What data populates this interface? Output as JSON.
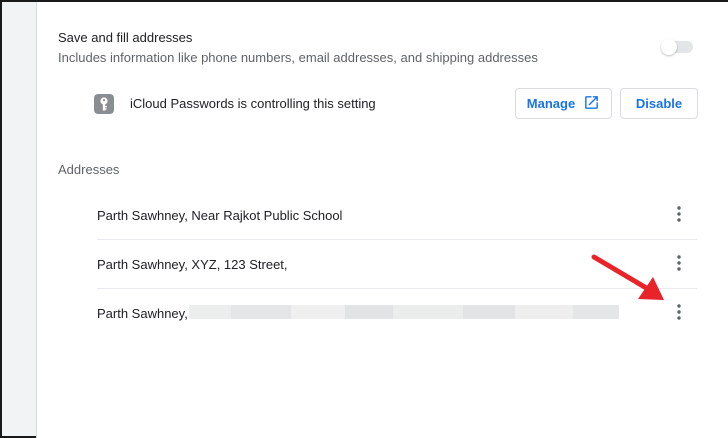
{
  "autofill": {
    "title": "Save and fill addresses",
    "subtitle": "Includes information like phone numbers, email addresses, and shipping addresses",
    "toggle_state": "off"
  },
  "policy": {
    "text": "iCloud Passwords is controlling this setting",
    "icon": "key-icon",
    "manage_label": "Manage",
    "manage_icon": "open-in-new-icon",
    "disable_label": "Disable"
  },
  "addresses": {
    "section_label": "Addresses",
    "items": [
      {
        "text": "Parth Sawhney, Near Rajkot Public School"
      },
      {
        "text": "Parth Sawhney, XYZ, 123 Street,"
      },
      {
        "text": "Parth Sawhney,"
      }
    ]
  },
  "colors": {
    "accent": "#1a73e8",
    "annotation_arrow": "#e8242a"
  }
}
